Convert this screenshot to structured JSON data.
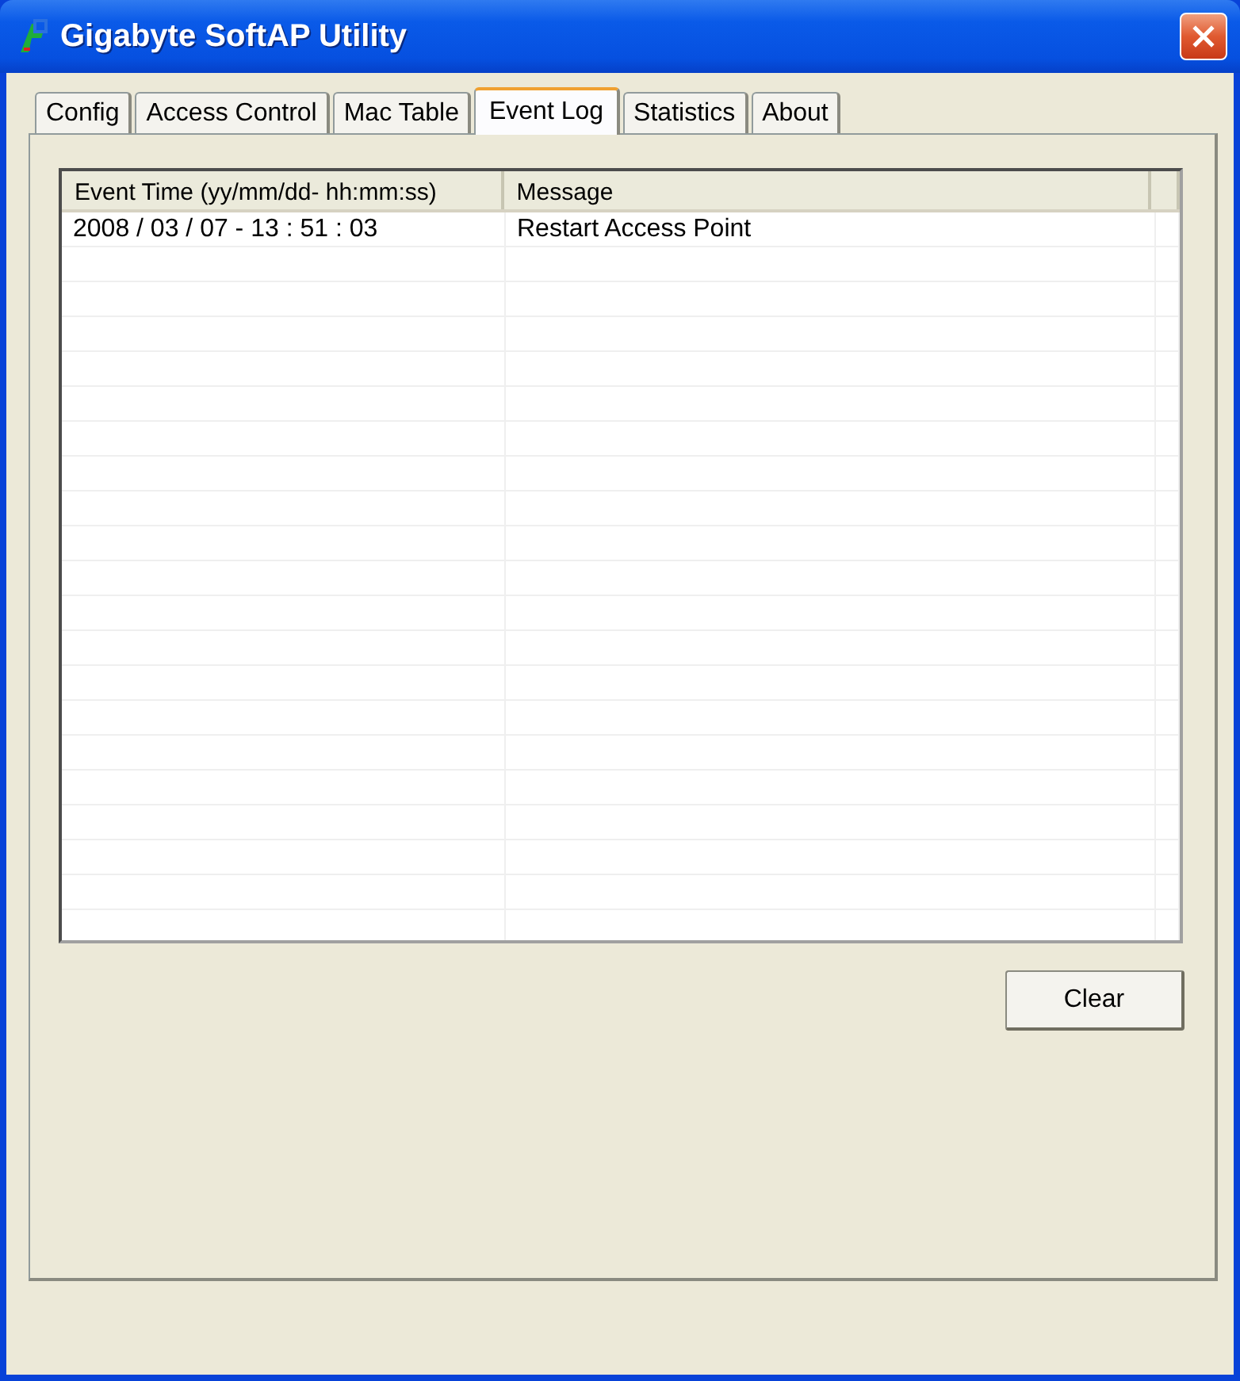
{
  "window": {
    "title": "Gigabyte SoftAP Utility"
  },
  "tabs": [
    {
      "label": "Config",
      "selected": false
    },
    {
      "label": "Access Control",
      "selected": false
    },
    {
      "label": "Mac Table",
      "selected": false
    },
    {
      "label": "Event Log",
      "selected": true
    },
    {
      "label": "Statistics",
      "selected": false
    },
    {
      "label": "About",
      "selected": false
    }
  ],
  "table": {
    "columns": [
      "Event Time (yy/mm/dd- hh:mm:ss)",
      "Message"
    ],
    "rows": [
      [
        "2008 / 03 / 07 - 13 : 51 : 03",
        "Restart Access Point"
      ]
    ]
  },
  "buttons": [
    "Clear"
  ]
}
